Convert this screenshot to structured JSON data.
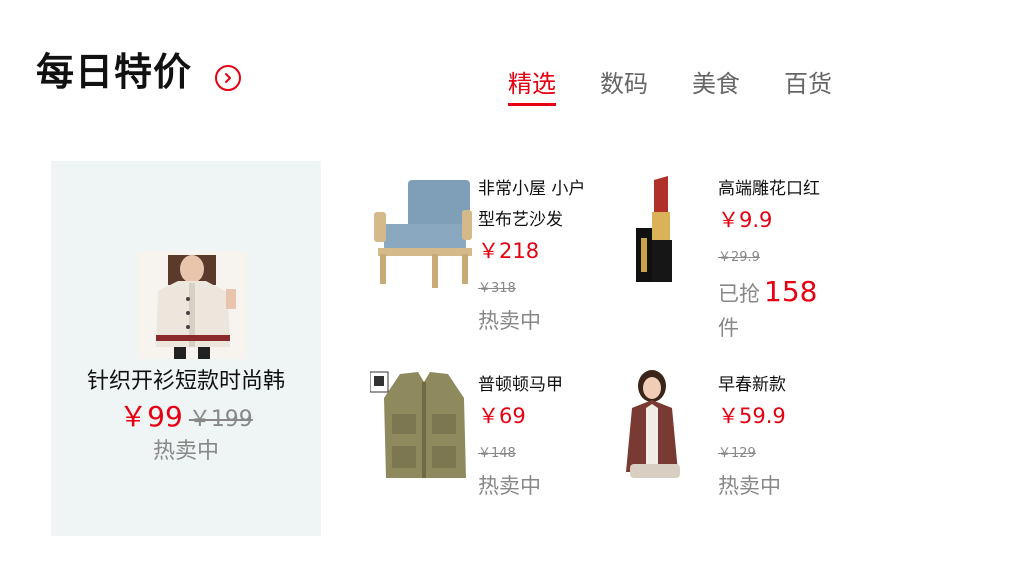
{
  "header": {
    "title": "每日特价",
    "more_icon": "chevron-right-circle-icon"
  },
  "tabs": [
    {
      "label": "精选",
      "active": true
    },
    {
      "label": "数码",
      "active": false
    },
    {
      "label": "美食",
      "active": false
    },
    {
      "label": "百货",
      "active": false
    }
  ],
  "featured": {
    "name": "针织开衫短款时尚韩",
    "price": "￥99",
    "original_price": "￥199",
    "status": "热卖中"
  },
  "products": [
    {
      "name": "非常小屋 小户型布艺沙发",
      "price": "￥218",
      "original_price": "￥318",
      "status": "热卖中"
    },
    {
      "name": "高端雕花口红",
      "price": "￥9.9",
      "original_price": "￥29.9",
      "sold_prefix": "已抢",
      "sold_count": "158",
      "sold_suffix": "件"
    },
    {
      "name": "普顿顿马甲",
      "price": "￥69",
      "original_price": "￥148",
      "status": "热卖中"
    },
    {
      "name": "早春新款",
      "price": "￥59.9",
      "original_price": "￥129",
      "status": "热卖中"
    }
  ],
  "colors": {
    "accent": "#e60012",
    "muted": "#888888",
    "featured_bg": "#eff4f4"
  }
}
